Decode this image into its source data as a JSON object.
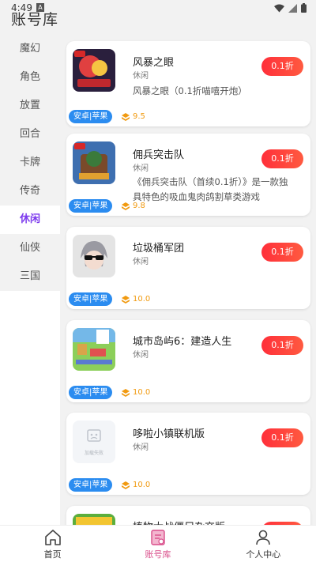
{
  "status": {
    "time": "4:49",
    "notice": "A"
  },
  "page_title": "账号库",
  "categories": [
    {
      "label": "魔幻"
    },
    {
      "label": "角色"
    },
    {
      "label": "放置"
    },
    {
      "label": "回合"
    },
    {
      "label": "卡牌"
    },
    {
      "label": "传奇"
    },
    {
      "label": "休闲",
      "active": true
    },
    {
      "label": "仙侠"
    },
    {
      "label": "三国"
    }
  ],
  "games": [
    {
      "name": "风暴之眼",
      "tag": "休闲",
      "desc": "风暴之眼（0.1折喵嘻开炮）",
      "discount": "0.1折",
      "platform": "安卓|苹果",
      "rating": "9.5"
    },
    {
      "name": "佣兵突击队",
      "tag": "休闲",
      "desc": "《佣兵突击队（首续0.1折）》是一款独具特色的吸血鬼肉鸽割草类游戏",
      "discount": "0.1折",
      "platform": "安卓|苹果",
      "rating": "9.8"
    },
    {
      "name": "垃圾桶军团",
      "tag": "休闲",
      "desc": "",
      "discount": "0.1折",
      "platform": "安卓|苹果",
      "rating": "10.0"
    },
    {
      "name": "城市岛屿6：建造人生",
      "tag": "休闲",
      "desc": "",
      "discount": "0.1折",
      "platform": "安卓|苹果",
      "rating": "10.0"
    },
    {
      "name": "哆啦小镇联机版",
      "tag": "休闲",
      "desc": "",
      "discount": "0.1折",
      "platform": "安卓|苹果",
      "rating": "10.0",
      "placeholder": "加载失败"
    },
    {
      "name": "植物大战僵尸杂交版",
      "tag": "",
      "desc": "",
      "discount": "",
      "platform": "",
      "rating": ""
    }
  ],
  "tabs": [
    {
      "label": "首页",
      "icon": "home-icon"
    },
    {
      "label": "账号库",
      "icon": "account-library-icon",
      "active": true
    },
    {
      "label": "个人中心",
      "icon": "profile-icon"
    }
  ],
  "colors": {
    "accent": "#7c3aed",
    "discount": "#ff2f3a",
    "platform": "#2b8cf0",
    "rating": "#f19a10",
    "tab_active": "#d94d8a"
  }
}
